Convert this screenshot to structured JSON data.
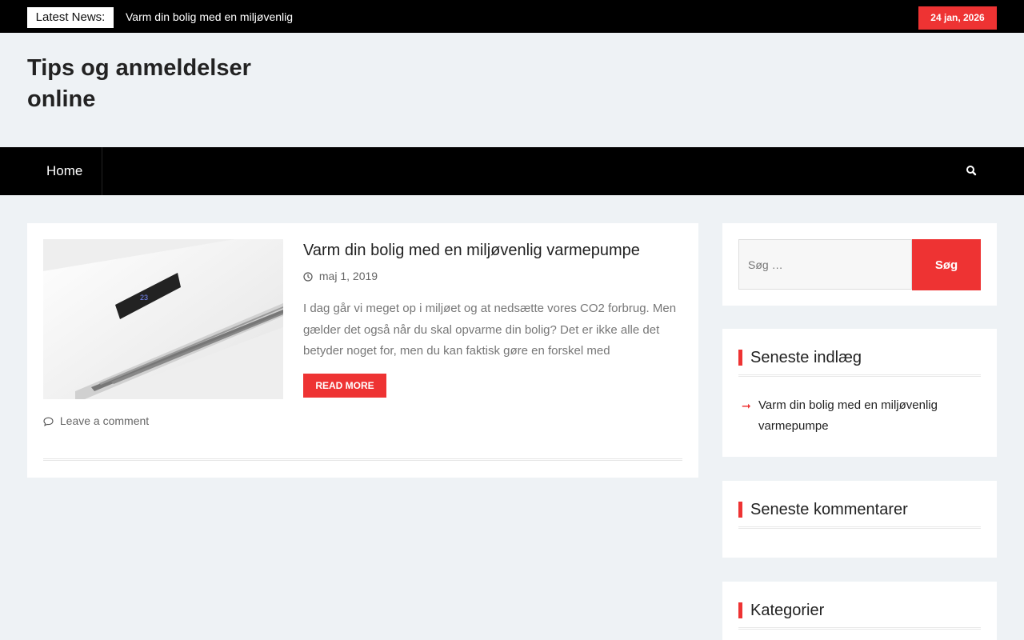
{
  "topbar": {
    "news_label": "Latest News:",
    "news_text": "Varm din bolig med en miljøvenlig",
    "date": "24 jan, 2026"
  },
  "header": {
    "site_title": "Tips og anmeldelser online"
  },
  "nav": {
    "home": "Home",
    "search_icon": "search-icon"
  },
  "post": {
    "title": "Varm din bolig med en miljøvenlig varmepumpe",
    "date": "maj 1, 2019",
    "excerpt": "I dag går vi meget op i miljøet og at nedsætte vores CO2 forbrug. Men gælder det også når du skal opvarme din bolig? Det er ikke alle det betyder noget for, men du kan faktisk gøre en forskel med",
    "read_more": "Read More",
    "comment_link": "Leave a comment",
    "thumb_display": "23"
  },
  "sidebar": {
    "search_placeholder": "Søg …",
    "search_button": "Søg",
    "recent_title": "Seneste indlæg",
    "recent_items": [
      "Varm din bolig med en miljøvenlig varmepumpe"
    ],
    "comments_title": "Seneste kommentarer",
    "categories_title": "Kategorier"
  },
  "colors": {
    "accent": "#ee3333",
    "background": "#eef2f5",
    "bar": "#000000"
  }
}
